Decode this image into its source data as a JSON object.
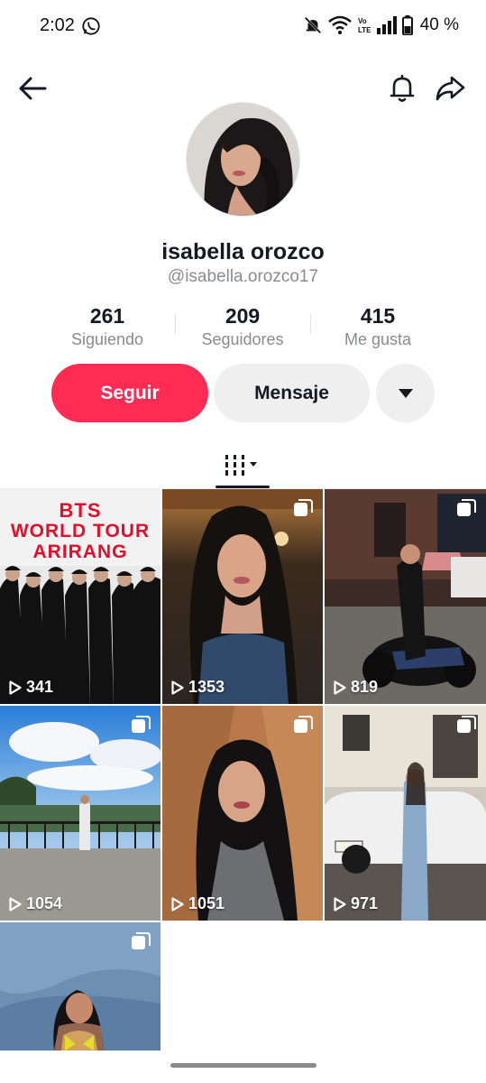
{
  "status_bar": {
    "time": "2:02",
    "battery": "40 %"
  },
  "nav": {
    "back_icon": "arrow-left-icon",
    "bell_icon": "bell-icon",
    "share_icon": "share-arrow-icon"
  },
  "profile": {
    "display_name": "isabella orozco",
    "username": "@isabella.orozco17"
  },
  "stats": [
    {
      "value": "261",
      "label": "Siguiendo"
    },
    {
      "value": "209",
      "label": "Seguidores"
    },
    {
      "value": "415",
      "label": "Me gusta"
    }
  ],
  "actions": {
    "follow": "Seguir",
    "message": "Mensaje"
  },
  "colors": {
    "accent": "#fe2c55",
    "secondary_button": "#efeff0",
    "muted_text": "#8a8b91"
  },
  "posts": [
    {
      "views": "341",
      "caption_lines": [
        "BTS",
        "WORLD TOUR",
        "ARIRANG"
      ]
    },
    {
      "views": "1353"
    },
    {
      "views": "819"
    },
    {
      "views": "1054"
    },
    {
      "views": "1051"
    },
    {
      "views": "971"
    },
    {
      "views": ""
    }
  ]
}
